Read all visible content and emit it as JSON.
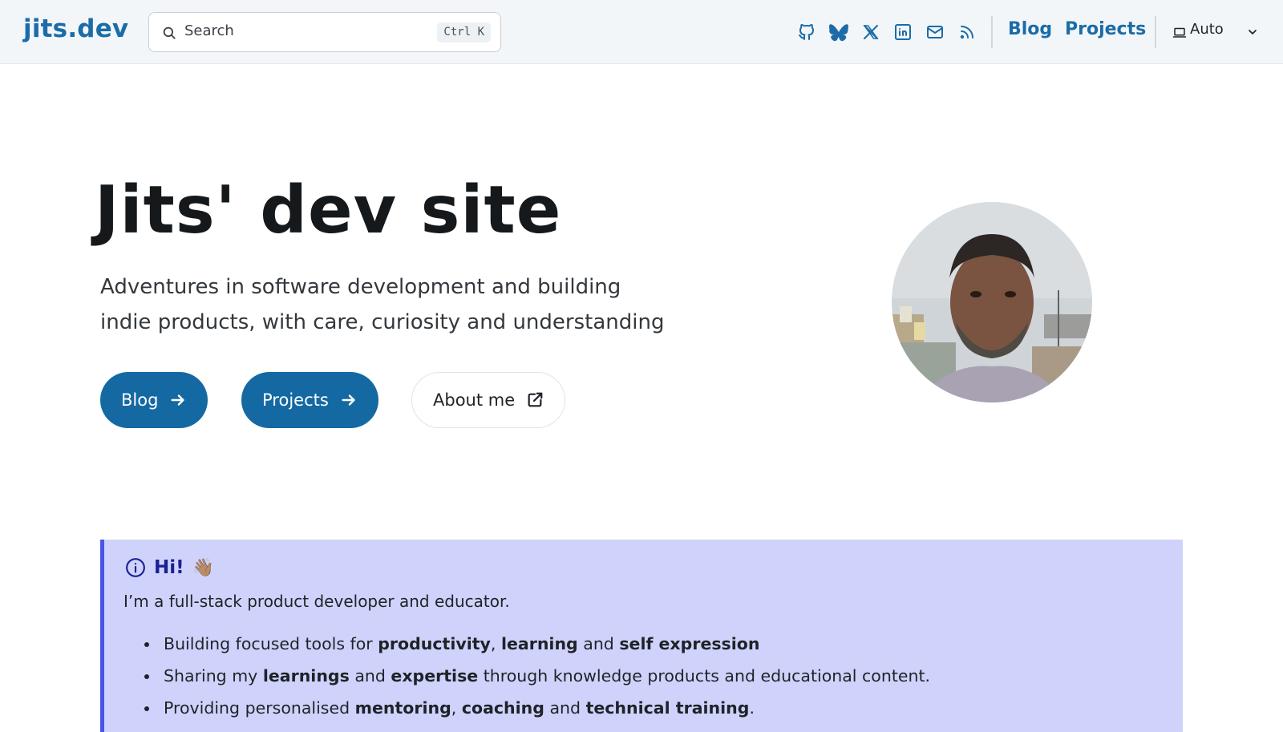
{
  "header": {
    "logo": "jits.dev",
    "search": {
      "placeholder": "Search",
      "shortcut": "Ctrl K"
    },
    "social_icons": [
      "github-icon",
      "bluesky-icon",
      "x-icon",
      "linkedin-icon",
      "mail-icon",
      "rss-icon"
    ],
    "nav": {
      "blog": "Blog",
      "projects": "Projects"
    },
    "theme": {
      "label": "Auto",
      "icon": "laptop-icon"
    }
  },
  "hero": {
    "title": "Jits' dev site",
    "subtitle": "Adventures in software development and building indie products, with care, curiosity and understanding",
    "buttons": {
      "blog": "Blog",
      "projects": "Projects",
      "about": "About me"
    }
  },
  "callout": {
    "title": "Hi!",
    "emoji": "👋🏽",
    "intro": "I’m a full-stack product developer and educator.",
    "items": [
      {
        "a": "Building focused tools for ",
        "b": "productivity",
        "c": ", ",
        "d": "learning",
        "e": " and ",
        "f": "self expression",
        "g": ""
      },
      {
        "a": "Sharing my ",
        "b": "learnings",
        "c": " and ",
        "d": "expertise",
        "e": " through knowledge products and educational content.",
        "f": "",
        "g": ""
      },
      {
        "a": "Providing personalised ",
        "b": "mentoring",
        "c": ", ",
        "d": "coaching",
        "e": " and ",
        "f": "technical training",
        "g": "."
      }
    ]
  },
  "colors": {
    "accent": "#1b6ca8",
    "button": "#1469a2",
    "callout_bg": "#cfd3fb",
    "callout_border": "#4a55e8",
    "callout_title": "#1a2095"
  }
}
